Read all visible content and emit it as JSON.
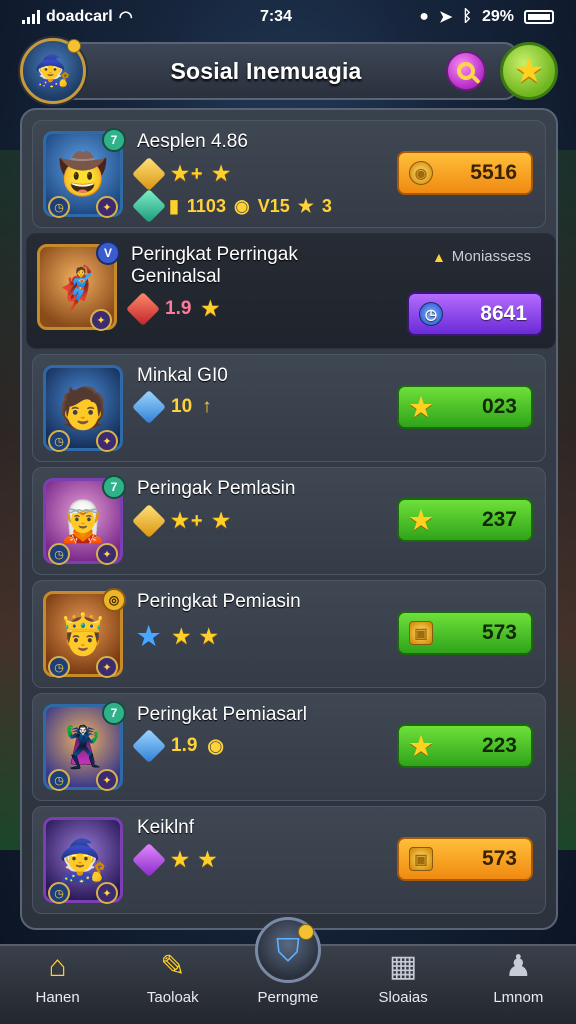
{
  "status_bar": {
    "carrier": "doadcarl",
    "time": "7:34",
    "battery": "29%"
  },
  "header": {
    "title": "Sosial Inemuagia"
  },
  "rows": [
    {
      "name": "Aesplen 4.86",
      "name2": "",
      "stats": "",
      "extra": "1103",
      "extra2": "V15",
      "extra3": "3",
      "score": "5516",
      "side_label": ""
    },
    {
      "name": "Peringkat Perringak",
      "name2": "Geninalsal",
      "stats": "1.9",
      "score": "8641",
      "side_label": "Moniassess"
    },
    {
      "name": "Minkal GI0",
      "stats": "10",
      "score": "023"
    },
    {
      "name": "Peringak Pemlasin",
      "stats": "",
      "score": "237"
    },
    {
      "name": "Peringkat Pemiasin",
      "stats": "",
      "score": "573"
    },
    {
      "name": "Peringkat Pemiasarl",
      "stats": "1.9",
      "score": "223"
    },
    {
      "name": "Keiklnf",
      "stats": "",
      "score": "573"
    }
  ],
  "nav": {
    "home": "Hanen",
    "tasks": "Taoloak",
    "ranking": "Perngme",
    "social": "Sloaias",
    "profile": "Lmnom"
  },
  "colors": {
    "orange": "#f08a12",
    "green": "#2fa41a",
    "purple": "#6a2ad6",
    "panel": "#2d333d"
  }
}
